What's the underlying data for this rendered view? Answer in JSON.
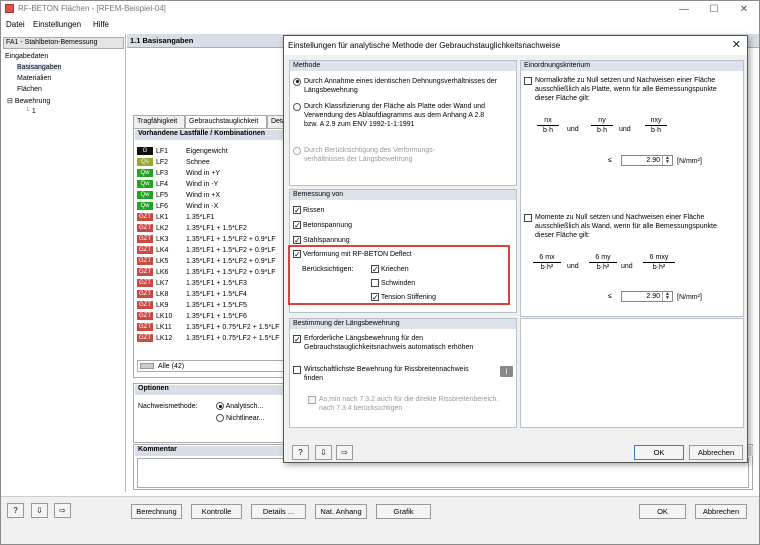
{
  "window": {
    "title": "RF-BETON Flächen - [RFEM-Beispiel-04]",
    "minimize": "—",
    "maximize": "☐",
    "close": "✕"
  },
  "menu": {
    "items": [
      "Datei",
      "Einstellungen",
      "Hilfe"
    ]
  },
  "left_pane": {
    "combo_value": "FA1 - Stahlbeton-Bemessung",
    "tree": [
      "Eingabedaten",
      "Basisangaben",
      "Materialien",
      "Flächen",
      "Bewehrung",
      "1"
    ]
  },
  "main": {
    "header": "1.1 Basisangaben",
    "tabs": [
      "Tragfähigkeit",
      "Gebrauchstauglichkeit",
      "Detai"
    ],
    "loadcases_header": "Vorhandene Lastfälle / Kombinationen",
    "loadcases": [
      {
        "tag": "G",
        "color": "#111111",
        "name": "LF1",
        "desc": "Eigengewicht"
      },
      {
        "tag": "Qs",
        "color": "#9aaa2a",
        "name": "LF2",
        "desc": "Schnee"
      },
      {
        "tag": "Qw",
        "color": "#1fa51f",
        "name": "LF3",
        "desc": "Wind in +Y"
      },
      {
        "tag": "Qw",
        "color": "#1fa51f",
        "name": "LF4",
        "desc": "Wind in -Y"
      },
      {
        "tag": "Qw",
        "color": "#1fa51f",
        "name": "LF5",
        "desc": "Wind in +X"
      },
      {
        "tag": "Qw",
        "color": "#1fa51f",
        "name": "LF6",
        "desc": "Wind in -X"
      },
      {
        "tag": "GZT",
        "color": "#cc4a44",
        "name": "LK1",
        "desc": "1.35*LF1"
      },
      {
        "tag": "GZT",
        "color": "#cc4a44",
        "name": "LK2",
        "desc": "1.35*LF1 + 1.5*LF2"
      },
      {
        "tag": "GZT",
        "color": "#cc4a44",
        "name": "LK3",
        "desc": "1.35*LF1 + 1.5*LF2 + 0.9*LF"
      },
      {
        "tag": "GZT",
        "color": "#cc4a44",
        "name": "LK4",
        "desc": "1.35*LF1 + 1.5*LF2 + 0.9*LF"
      },
      {
        "tag": "GZT",
        "color": "#cc4a44",
        "name": "LK5",
        "desc": "1.35*LF1 + 1.5*LF2 + 0.9*LF"
      },
      {
        "tag": "GZT",
        "color": "#cc4a44",
        "name": "LK6",
        "desc": "1.35*LF1 + 1.5*LF2 + 0.9*LF"
      },
      {
        "tag": "GZT",
        "color": "#cc4a44",
        "name": "LK7",
        "desc": "1.35*LF1 + 1.5*LF3"
      },
      {
        "tag": "GZT",
        "color": "#cc4a44",
        "name": "LK8",
        "desc": "1.35*LF1 + 1.5*LF4"
      },
      {
        "tag": "GZT",
        "color": "#cc4a44",
        "name": "LK9",
        "desc": "1.35*LF1 + 1.5*LF5"
      },
      {
        "tag": "GZT",
        "color": "#cc4a44",
        "name": "LK10",
        "desc": "1.35*LF1 + 1.5*LF6"
      },
      {
        "tag": "GZT",
        "color": "#cc4a44",
        "name": "LK11",
        "desc": "1.35*LF1 + 0.75*LF2 + 1.5*LF"
      },
      {
        "tag": "GZT",
        "color": "#cc4a44",
        "name": "LK12",
        "desc": "1.35*LF1 + 0.75*LF2 + 1.5*LF"
      }
    ],
    "filter_value": "Alle (42)",
    "options_header": "Optionen",
    "nachweis_label": "Nachweismethode:",
    "method_a": "Analytisch...",
    "method_b": "Nichtlinear...",
    "comment_header": "Kommentar"
  },
  "bottom": {
    "buttons": [
      "Berechnung",
      "Kontrolle",
      "Details ...",
      "Nat. Anhang",
      "Grafik"
    ],
    "ok": "OK",
    "cancel": "Abbrechen",
    "icons": [
      "?",
      "⇩",
      "⇨"
    ]
  },
  "dialog": {
    "title": "Einstellungen für analytische Methode der Gebrauchstauglichkeitsnachweise",
    "methode": {
      "header": "Methode",
      "opt1": [
        "Durch Annahme eines identischen Dehnungsverhältnisses der",
        "Längsbewehrung"
      ],
      "opt2": [
        "Durch Klassifizierung der Fläche als Platte oder Wand und",
        "Verwendung des Ablaufdiagramms aus dem Anhang A 2.8",
        "bzw. A 2.9 zum ENV 1992-1-1:1991"
      ],
      "opt3": [
        "Durch Berücksichtigung des Verformungs-",
        "verhältnisses der Längsbewehrung"
      ],
      "selected": 1
    },
    "bemessung": {
      "header": "Bemessung von",
      "rissen": "Rissen",
      "betonspannung": "Betonspannung",
      "stahlspannung": "Stahlspannung",
      "verformung": "Verformung mit RF-BETON Deflect",
      "beruecksichtigen": "Berücksichtigen:",
      "kriechen": "Kriechen",
      "schwinden": "Schwinden",
      "tension": "Tension Stiffening"
    },
    "laengs": {
      "header": "Bestimmung der Längsbewehrung",
      "erforderlich": [
        "Erforderliche Längsbewehrung für den",
        "Gebrauchstauglichkeitsnachweis automatisch erhöhen"
      ],
      "wirtschaftlich": [
        "Wirtschaftlichste Bewehrung für Rissbreitennachweis",
        "finden"
      ],
      "asmin": [
        "As,min nach 7.3.2 auch für die direkte Rissbreitenbereich.",
        "nach 7.3.4 berücksichtigen"
      ]
    },
    "einordnung": {
      "header": "Einordnungskriterium",
      "platte_text": [
        "Normalkräfte zu Null setzen und Nachweisen einer Fläche",
        "ausschließlich als Platte, wenn für alle Bemessungspunkte",
        "dieser Fläche gilt:"
      ],
      "wand_text": [
        "Momente zu Null setzen und Nachweisen einer Fläche",
        "ausschließlich als Wand, wenn für alle Bemessungspunkte",
        "dieser Fläche gilt:"
      ],
      "und": "und",
      "le": "≤",
      "value1": "2.90",
      "value2": "2.90",
      "unit": "[N/mm²]",
      "frac_top1": [
        "nx",
        "ny",
        "nxy"
      ],
      "frac_bot1": [
        "b·h",
        "b·h",
        "b·h"
      ],
      "frac_top2": [
        "6 mx",
        "6 my",
        "6 mxy"
      ],
      "frac_bot2": [
        "b·h²",
        "b·h²",
        "b·h²"
      ]
    },
    "ok": "OK",
    "cancel": "Abbrechen",
    "icons": [
      "?",
      "⇩",
      "⇨"
    ]
  }
}
